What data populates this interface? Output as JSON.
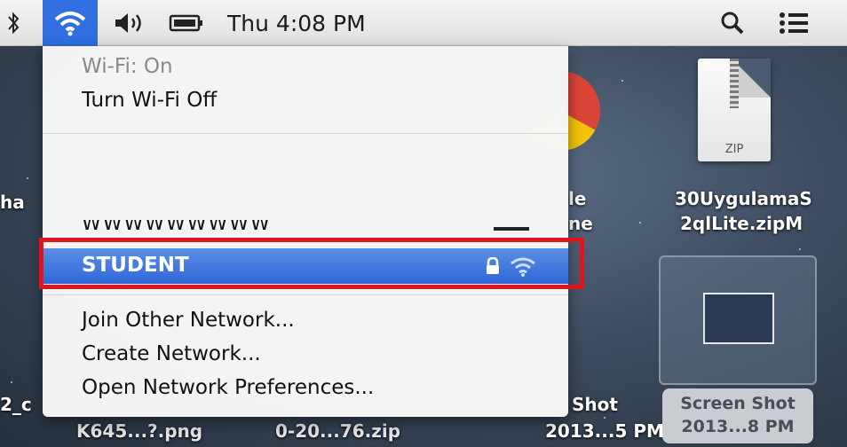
{
  "menubar": {
    "clock": "Thu 4:08 PM",
    "icons": [
      "bluetooth-icon",
      "wifi-icon",
      "volume-icon",
      "battery-icon",
      "spotlight-icon",
      "notification-list-icon"
    ]
  },
  "wifi_menu": {
    "status": "Wi-Fi: On",
    "toggle": "Turn Wi-Fi Off",
    "network": "STUDENT",
    "join_other": "Join Other Network...",
    "create": "Create Network...",
    "preferences": "Open Network Preferences..."
  },
  "desktop": {
    "left_label_top": "ha",
    "left_label_bottom": "2_c",
    "bottom_label_1": "K645...?.png",
    "bottom_label_2": "0-20...76.zip",
    "chrome_label_1": "le",
    "chrome_label_2": "ne",
    "shot_label_1": "Shot",
    "shot_label_2": "2013...5 PM",
    "zip_tag": "ZIP",
    "zip_name_1": "30UygulamaS",
    "zip_name_2": "2qlLite.zipM",
    "screenshot_1": "Screen Shot",
    "screenshot_2": "2013...8 PM"
  },
  "colors": {
    "highlight_border": "#e0141c",
    "selected_row": "#2f67d8",
    "menubar_active": "#2f6fe0"
  }
}
